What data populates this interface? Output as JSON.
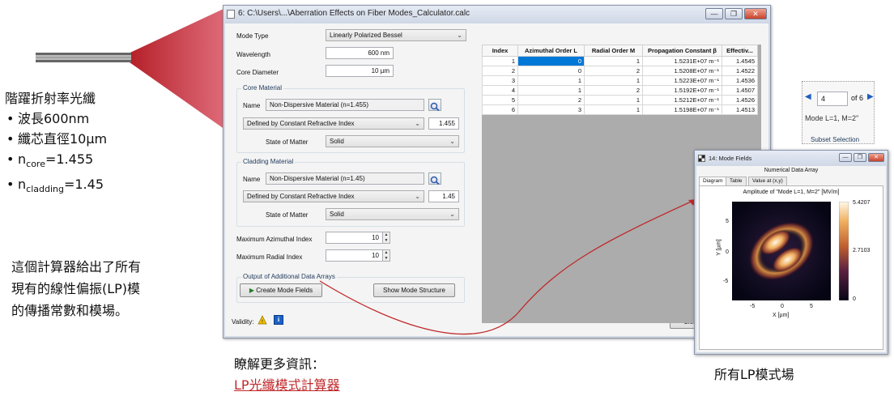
{
  "annotation": {
    "title": "階躍折射率光纖",
    "bullets": [
      "波長600nm",
      "纖芯直徑10μm"
    ],
    "ncore_prefix": "n",
    "ncore_sub": "core",
    "ncore_val": "=1.455",
    "nclad_prefix": "n",
    "nclad_sub": "cladding",
    "nclad_val": "=1.45",
    "desc1": "這個計算器給出了所有",
    "desc2": "現有的線性偏振(LP)模",
    "desc3": "的傳播常數和模場。"
  },
  "main_window": {
    "title": "6: C:\\Users\\...\\Aberration Effects on Fiber Modes_Calculator.calc",
    "mode_type_label": "Mode Type",
    "mode_type_value": "Linearly Polarized Bessel",
    "wavelength_label": "Wavelength",
    "wavelength_value": "600 nm",
    "core_diameter_label": "Core Diameter",
    "core_diameter_value": "10 µm",
    "core_material": {
      "group_title": "Core Material",
      "name_label": "Name",
      "name_value": "Non-Dispersive Material (n=1.455)",
      "define_value": "Defined by Constant Refractive Index",
      "index_value": "1.455",
      "state_label": "State of Matter",
      "state_value": "Solid"
    },
    "cladding_material": {
      "group_title": "Cladding Material",
      "name_label": "Name",
      "name_value": "Non-Dispersive Material (n=1.45)",
      "define_value": "Defined by Constant Refractive Index",
      "index_value": "1.45",
      "state_label": "State of Matter",
      "state_value": "Solid"
    },
    "max_azimuthal_label": "Maximum Azimuthal Index",
    "max_azimuthal_value": "10",
    "max_radial_label": "Maximum Radial Index",
    "max_radial_value": "10",
    "output_group_title": "Output of Additional Data Arrays",
    "create_button": "Create Mode Fields",
    "show_button": "Show Mode Structure",
    "validity_label": "Validity:",
    "close_button": "Clos",
    "table": {
      "headers": [
        "Index",
        "Azimuthal Order L",
        "Radial Order M",
        "Propagation Constant β",
        "Effectiv..."
      ],
      "rows": [
        [
          "1",
          "0",
          "1",
          "1.5231E+07 m⁻¹",
          "1.4545"
        ],
        [
          "2",
          "0",
          "2",
          "1.5208E+07 m⁻¹",
          "1.4522"
        ],
        [
          "3",
          "1",
          "1",
          "1.5223E+07 m⁻¹",
          "1.4536"
        ],
        [
          "4",
          "1",
          "2",
          "1.5192E+07 m⁻¹",
          "1.4507"
        ],
        [
          "5",
          "2",
          "1",
          "1.5212E+07 m⁻¹",
          "1.4526"
        ],
        [
          "6",
          "3",
          "1",
          "1.5198E+07 m⁻¹",
          "1.4513"
        ]
      ]
    }
  },
  "subset": {
    "value": "4",
    "of_text": "of 6",
    "mode_label": "Mode L=1, M=2\"",
    "caption": "Subset Selection"
  },
  "mode_fields_window": {
    "title": "14: Mode Fields",
    "header": "Numerical Data Array",
    "tabs": [
      "Diagram",
      "Table",
      "Value at (x,y)"
    ],
    "plot_title": "Amplitude of \"Mode L=1, M=2\"   [MV/m]",
    "colorbar_max": "5.4207",
    "colorbar_mid": "2.7103",
    "colorbar_min": "0",
    "xlabel": "X [µm]",
    "ylabel": "Y [µm]",
    "xticks": [
      "-5",
      "0",
      "5"
    ],
    "yticks": [
      "5",
      "0",
      "-5"
    ]
  },
  "footer": {
    "more_info": "瞭解更多資訊：",
    "link": "LP光纖模式計算器",
    "caption": "所有LP模式場"
  },
  "colors": {
    "accent_red": "#c0282a",
    "selection_blue": "#0078d7"
  }
}
